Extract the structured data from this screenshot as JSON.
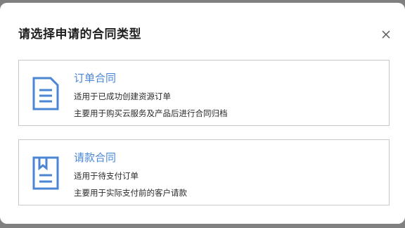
{
  "dialog": {
    "title": "请选择申请的合同类型",
    "close_icon": "close-icon"
  },
  "options": [
    {
      "title": "订单合同",
      "desc1": "适用于已成功创建资源订单",
      "desc2": "主要用于购买云服务及产品后进行合同归档",
      "icon": "document-icon"
    },
    {
      "title": "请款合同",
      "desc1": "适用于待支付订单",
      "desc2": "主要用于实际支付前的客户请款",
      "icon": "bookmark-document-icon"
    }
  ],
  "colors": {
    "accent": "#4a86d4",
    "border": "#c8c8c8",
    "overlay": "#808080"
  }
}
